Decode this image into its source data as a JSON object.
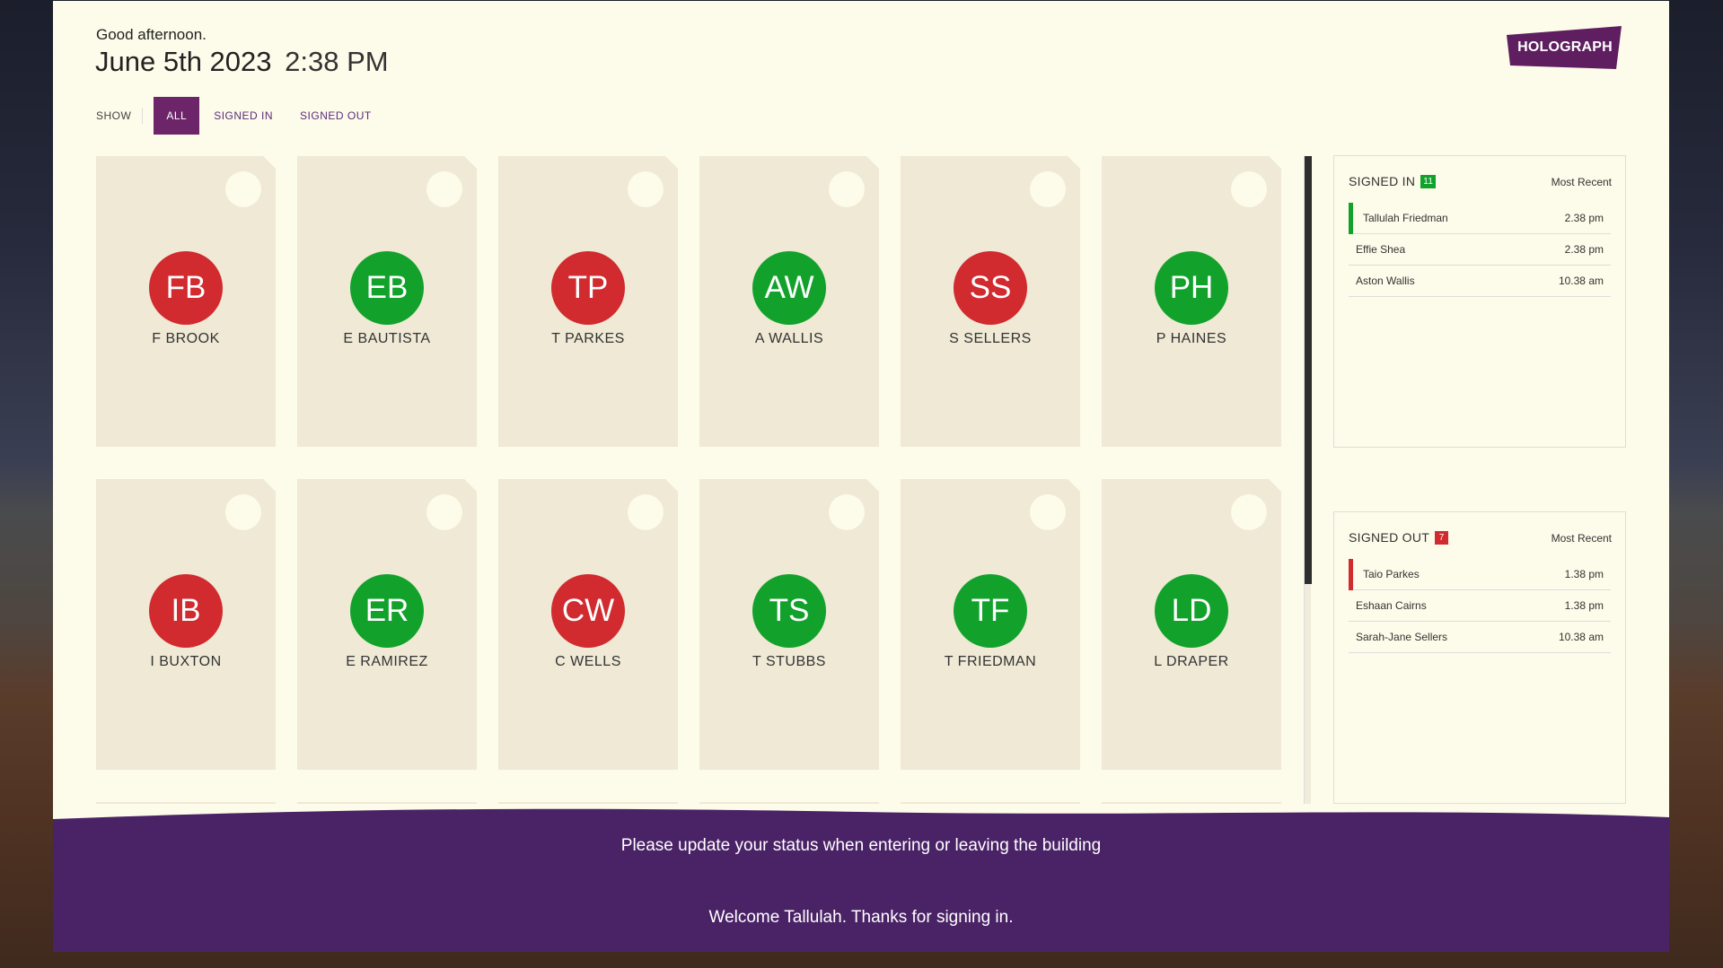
{
  "header": {
    "greeting": "Good afternoon.",
    "date": "June 5th 2023",
    "time": "2:38 PM"
  },
  "brand": {
    "logo_text": "HOLOGRAPH",
    "color": "#5e1e5f"
  },
  "filter": {
    "label": "SHOW",
    "options": [
      "ALL",
      "SIGNED IN",
      "SIGNED OUT"
    ],
    "selected": "ALL"
  },
  "people": [
    {
      "initials": "FB",
      "name": "F BROOK",
      "status": "out"
    },
    {
      "initials": "EB",
      "name": "E BAUTISTA",
      "status": "in"
    },
    {
      "initials": "TP",
      "name": "T PARKES",
      "status": "out"
    },
    {
      "initials": "AW",
      "name": "A WALLIS",
      "status": "in"
    },
    {
      "initials": "SS",
      "name": "S SELLERS",
      "status": "out"
    },
    {
      "initials": "PH",
      "name": "P HAINES",
      "status": "in"
    },
    {
      "initials": "IB",
      "name": "I BUXTON",
      "status": "out"
    },
    {
      "initials": "ER",
      "name": "E RAMIREZ",
      "status": "in"
    },
    {
      "initials": "CW",
      "name": "C WELLS",
      "status": "out"
    },
    {
      "initials": "TS",
      "name": "T STUBBS",
      "status": "in"
    },
    {
      "initials": "TF",
      "name": "T FRIEDMAN",
      "status": "in"
    },
    {
      "initials": "LD",
      "name": "L DRAPER",
      "status": "in"
    }
  ],
  "signed_in": {
    "title": "SIGNED IN",
    "count": "11",
    "sort": "Most Recent",
    "entries": [
      {
        "name": "Tallulah Friedman",
        "time": "2.38 pm"
      },
      {
        "name": "Effie Shea",
        "time": "2.38 pm"
      },
      {
        "name": "Aston Wallis",
        "time": "10.38 am"
      }
    ]
  },
  "signed_out": {
    "title": "SIGNED OUT",
    "count": "7",
    "sort": "Most Recent",
    "entries": [
      {
        "name": "Taio Parkes",
        "time": "1.38 pm"
      },
      {
        "name": "Eshaan Cairns",
        "time": "1.38 pm"
      },
      {
        "name": "Sarah-Jane Sellers",
        "time": "10.38 am"
      }
    ]
  },
  "footer": {
    "notice": "Please update your status when entering or leaving the building",
    "welcome": "Welcome Tallulah. Thanks for signing in."
  },
  "colors": {
    "panel": "#fdfbe9",
    "signed_in": "#12a22c",
    "signed_out": "#d12a2f",
    "footer": "#4a2266",
    "filter_active": "#6b2568"
  }
}
